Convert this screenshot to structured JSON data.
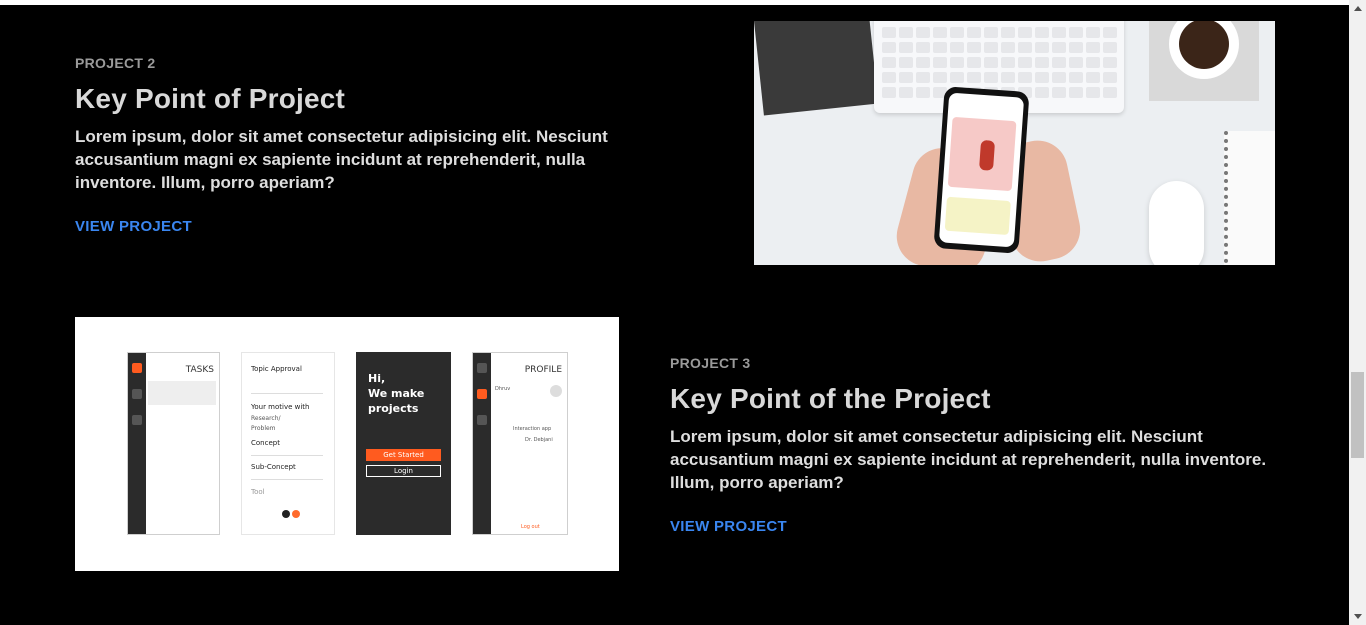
{
  "projects": [
    {
      "eyebrow": "PROJECT 2",
      "title": "Key Point of Project",
      "description": "Lorem ipsum, dolor sit amet consectetur adipisicing elit. Nesciunt accusantium magni ex sapiente incidunt at reprehenderit, nulla inventore. Illum, porro aperiam?",
      "link_label": "VIEW PROJECT"
    },
    {
      "eyebrow": "PROJECT 3",
      "title": "Key Point of the Project",
      "description": "Lorem ipsum, dolor sit amet consectetur adipisicing elit. Nesciunt accusantium magni ex sapiente incidunt at reprehenderit, nulla inventore. Illum, porro aperiam?",
      "link_label": "VIEW PROJECT"
    }
  ],
  "mockups": {
    "tasks_title": "TASKS",
    "topic_title": "Topic Approval",
    "motive_label": "Your motive with",
    "research_option": "Research/",
    "problem_option": "Problem",
    "concept_label": "Concept",
    "sub_concept_label": "Sub-Concept",
    "tool_label": "Tool",
    "hero_text": "Hi,\nWe make\nprojects",
    "get_started": "Get Started",
    "login": "Login",
    "profile_title": "PROFILE",
    "profile_name": "Dhruv",
    "profile_app": "Interaction app",
    "profile_guide": "Dr. Debjani",
    "logout": "Log out"
  },
  "colors": {
    "background": "#000000",
    "link": "#3a86f0",
    "accent": "#ff5b1f"
  }
}
